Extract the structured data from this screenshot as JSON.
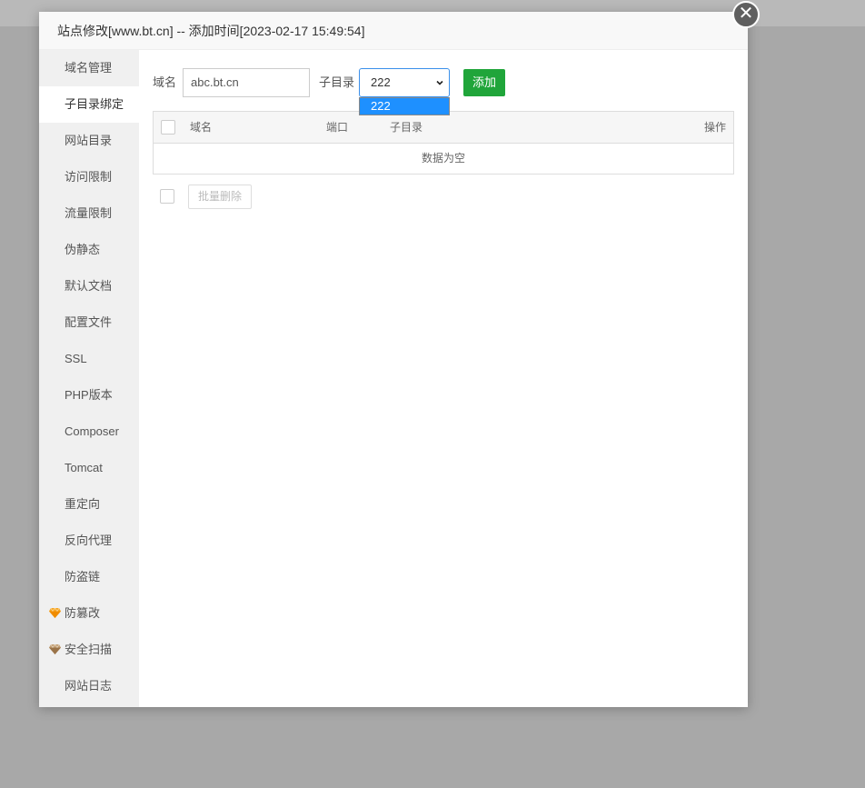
{
  "dialog": {
    "title": "站点修改[www.bt.cn] -- 添加时间[2023-02-17 15:49:54]",
    "close_symbol": "✕"
  },
  "sidebar": {
    "items": [
      {
        "label": "域名管理"
      },
      {
        "label": "子目录绑定",
        "active": true
      },
      {
        "label": "网站目录"
      },
      {
        "label": "访问限制"
      },
      {
        "label": "流量限制"
      },
      {
        "label": "伪静态"
      },
      {
        "label": "默认文档"
      },
      {
        "label": "配置文件"
      },
      {
        "label": "SSL"
      },
      {
        "label": "PHP版本"
      },
      {
        "label": "Composer"
      },
      {
        "label": "Tomcat"
      },
      {
        "label": "重定向"
      },
      {
        "label": "反向代理"
      },
      {
        "label": "防盗链"
      },
      {
        "label": "防篡改",
        "icon": "gem-gold-icon"
      },
      {
        "label": "安全扫描",
        "icon": "gem-brown-icon"
      },
      {
        "label": "网站日志"
      }
    ]
  },
  "form": {
    "domain_label": "域名",
    "domain_value": "abc.bt.cn",
    "subdir_label": "子目录",
    "subdir_value": "222",
    "subdir_options": [
      "222"
    ],
    "add_label": "添加"
  },
  "table": {
    "columns": [
      "域名",
      "端口",
      "子目录",
      "操作"
    ],
    "empty_text": "数据为空"
  },
  "batch": {
    "delete_label": "批量删除"
  },
  "colors": {
    "accent_green": "#20a53a",
    "select_blue": "#1e90ff",
    "gem_gold": "#f6a623",
    "gem_brown": "#b08a5a"
  }
}
